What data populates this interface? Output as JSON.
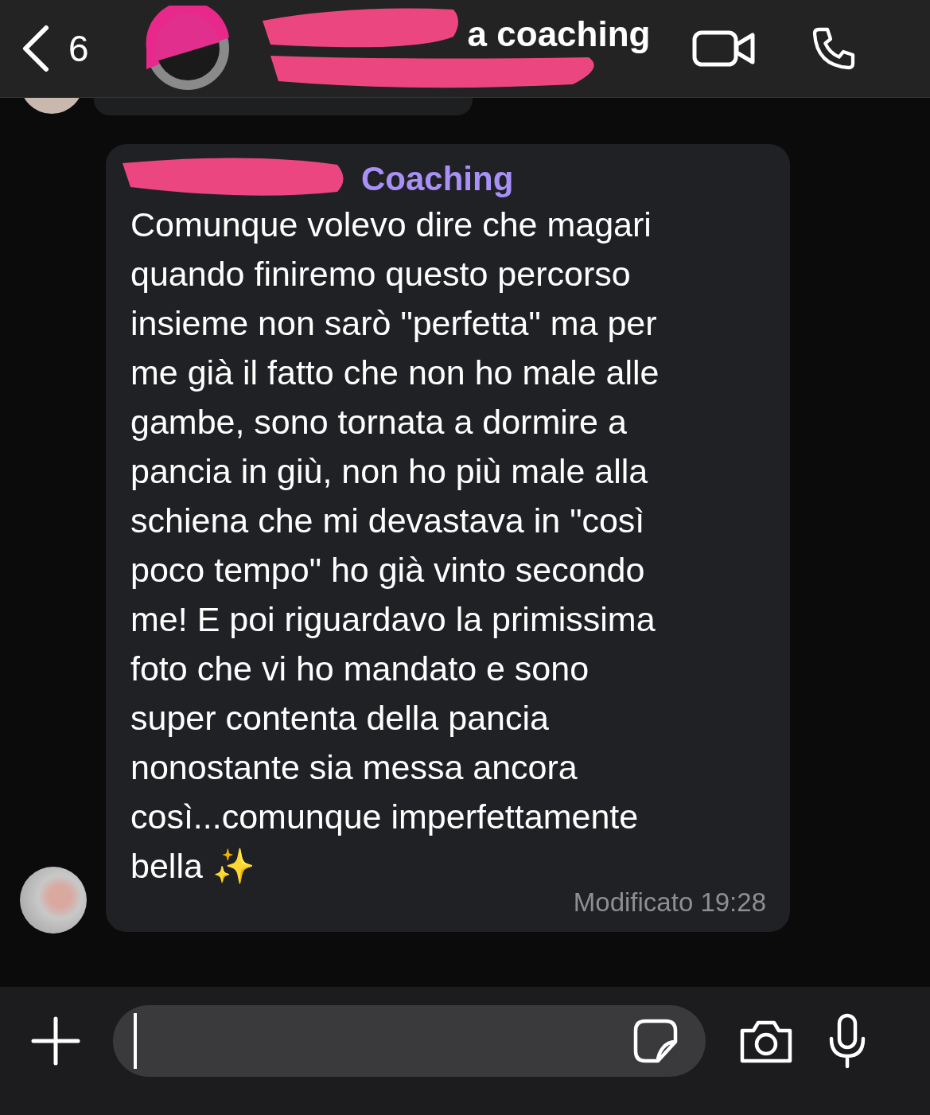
{
  "header": {
    "back_count": "6",
    "title": "a coaching"
  },
  "message": {
    "sender": "Coaching",
    "lines": [
      "Comunque volevo dire che magari",
      "quando finiremo questo percorso",
      "insieme non sarò \"perfetta\" ma per",
      "me già il fatto che non ho male alle",
      "gambe, sono tornata a dormire a",
      "pancia in giù, non ho più male alla",
      "schiena che mi devastava in \"così",
      "poco tempo\"  ho già vinto secondo",
      "me! E poi riguardavo la primissima",
      "foto che vi ho mandato e sono",
      "super contenta della pancia",
      "nonostante sia messa ancora",
      "così...comunque imperfettamente",
      "bella ✨"
    ],
    "edited_label": "Modificato",
    "time": "19:28"
  }
}
